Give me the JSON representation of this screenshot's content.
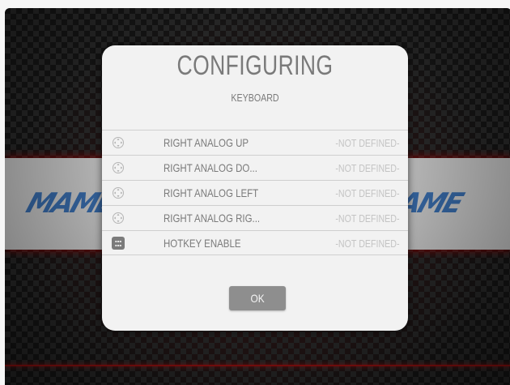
{
  "background": {
    "logo_left": "MAME",
    "logo_right": "AME",
    "accent_color": "#8a0f0f"
  },
  "dialog": {
    "title": "CONFIGURING",
    "subtitle": "KEYBOARD",
    "rows": [
      {
        "icon": "dpad-icon",
        "label": "RIGHT ANALOG UP",
        "value": "-NOT DEFINED-"
      },
      {
        "icon": "dpad-icon",
        "label": "RIGHT ANALOG DO...",
        "value": "-NOT DEFINED-"
      },
      {
        "icon": "dpad-icon",
        "label": "RIGHT ANALOG LEFT",
        "value": "-NOT DEFINED-"
      },
      {
        "icon": "dpad-icon",
        "label": "RIGHT ANALOG RIG...",
        "value": "-NOT DEFINED-"
      },
      {
        "icon": "hotkey-icon",
        "label": "HOTKEY ENABLE",
        "value": "-NOT DEFINED-"
      }
    ],
    "ok_label": "OK"
  }
}
